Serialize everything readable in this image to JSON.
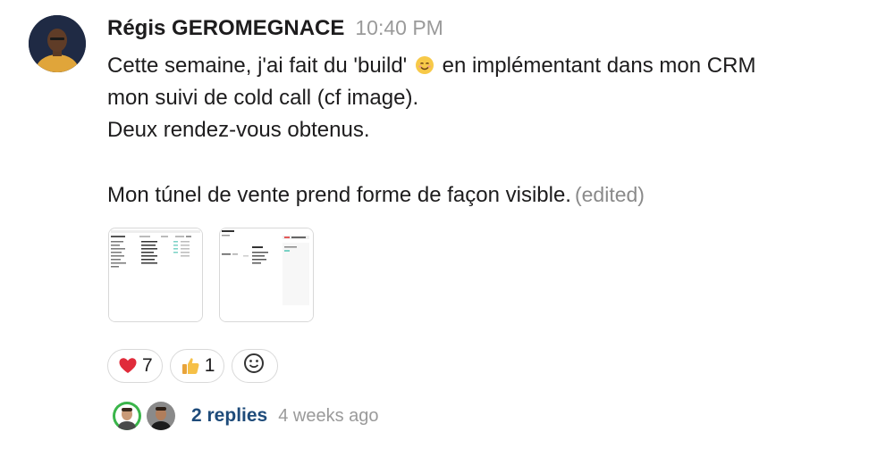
{
  "message": {
    "author": "Régis GEROMEGNACE",
    "timestamp": "10:40 PM",
    "lines": {
      "line1_before_emoji": "Cette semaine, j'ai fait du 'build'",
      "line1_emoji": "smiling-face-emoji",
      "line1_after_emoji": "en implémentant dans mon CRM",
      "line2": "mon suivi de cold call (cf image).",
      "line3": "Deux rendez-vous obtenus.",
      "line5": "Mon túnel de vente prend forme de façon visible."
    },
    "edited_label": "(edited)"
  },
  "attachments": [
    {
      "name": "crm-table-screenshot"
    },
    {
      "name": "crm-pipeline-screenshot"
    }
  ],
  "reactions": [
    {
      "emoji": "red-heart-emoji",
      "count": "7"
    },
    {
      "emoji": "thumbs-up-emoji",
      "count": "1"
    }
  ],
  "add_reaction_icon": "add-reaction-icon",
  "thread": {
    "replies_label": "2 replies",
    "last_reply": "4 weeks ago"
  },
  "colors": {
    "replies_link": "#1e4b7a",
    "muted": "#9a9a9a",
    "avatar_bg": "#1f2a44"
  }
}
